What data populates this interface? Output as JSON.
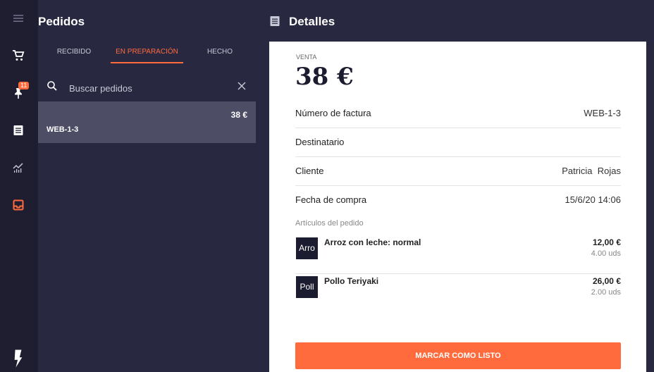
{
  "rail": {
    "badge_count": "11",
    "icons": [
      "menu-icon",
      "cart-icon",
      "pin-icon",
      "list-icon",
      "analytics-icon",
      "inbox-icon",
      "logo"
    ]
  },
  "orders": {
    "title": "Pedidos",
    "tabs": [
      {
        "label": "RECIBIDO",
        "active": false
      },
      {
        "label": "EN PREPARACIÓN",
        "active": true
      },
      {
        "label": "HECHO",
        "active": false
      }
    ],
    "search": {
      "placeholder": "Buscar pedidos",
      "value": ""
    },
    "list": [
      {
        "id": "WEB-1-3",
        "amount": "38 €",
        "selected": true
      }
    ]
  },
  "details": {
    "title": "Detalles",
    "sale_label": "VENTA",
    "sale_total": "38 €",
    "fields": [
      {
        "label": "Número de factura",
        "value": "WEB-1-3"
      },
      {
        "label": "Destinatario",
        "value": ""
      },
      {
        "label": "Cliente",
        "value": "Patricia  Rojas"
      },
      {
        "label": "Fecha de compra",
        "value": "15/6/20 14:06"
      }
    ],
    "items_label": "Artículos del pedido",
    "items": [
      {
        "thumb": "Arro",
        "name": "Arroz con leche: normal",
        "price": "12,00 €",
        "qty": "4.00 uds"
      },
      {
        "thumb": "Poll",
        "name": "Pollo Teriyaki",
        "price": "26,00 €",
        "qty": "2.00 uds"
      }
    ],
    "ready_button": "MARCAR COMO LISTO"
  },
  "colors": {
    "accent": "#ff6b3d",
    "rail_bg": "#1e1e30",
    "panel_bg": "#282840",
    "selected_row": "#4d4d66"
  }
}
